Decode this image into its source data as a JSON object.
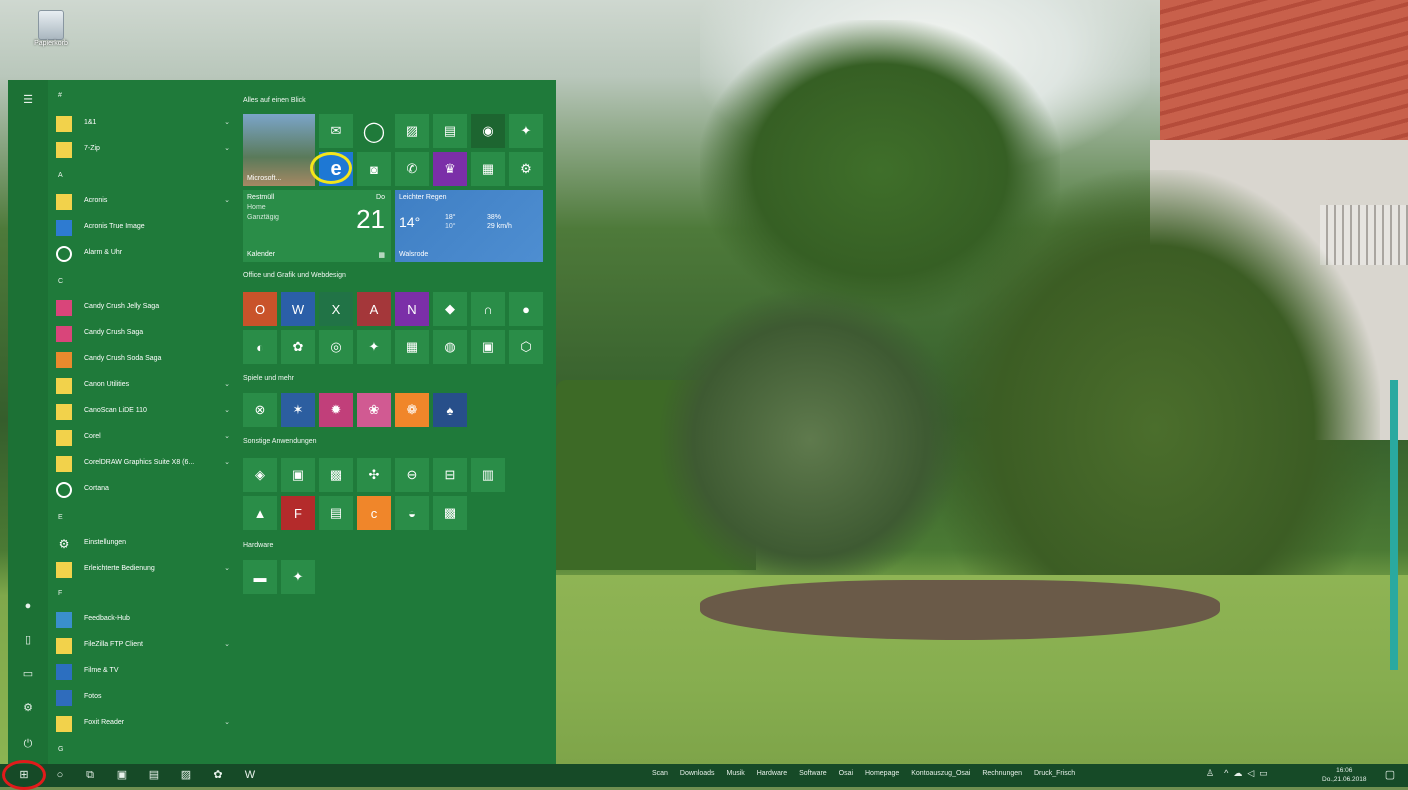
{
  "desktop": {
    "recycle_bin_label": "Papierkorb"
  },
  "start_menu": {
    "groups": {
      "hash": "#",
      "a": "A",
      "c": "C",
      "e": "E",
      "f": "F",
      "g": "G"
    },
    "apps": [
      {
        "label": "1&1",
        "chevron": "⌄"
      },
      {
        "label": "7-Zip",
        "chevron": "⌄"
      },
      {
        "label": "Acronis",
        "chevron": "⌄"
      },
      {
        "label": "Acronis True Image"
      },
      {
        "label": "Alarm & Uhr"
      },
      {
        "label": "Candy Crush Jelly Saga"
      },
      {
        "label": "Candy Crush Saga"
      },
      {
        "label": "Candy Crush Soda Saga"
      },
      {
        "label": "Canon Utilities",
        "chevron": "⌄"
      },
      {
        "label": "CanoScan LiDE 110",
        "chevron": "⌄"
      },
      {
        "label": "Corel",
        "chevron": "⌄"
      },
      {
        "label": "CorelDRAW Graphics Suite X8 (6...",
        "chevron": "⌄"
      },
      {
        "label": "Cortana"
      },
      {
        "label": "Einstellungen"
      },
      {
        "label": "Erleichterte Bedienung",
        "chevron": "⌄"
      },
      {
        "label": "Feedback-Hub"
      },
      {
        "label": "FileZilla FTP Client",
        "chevron": "⌄"
      },
      {
        "label": "Filme & TV"
      },
      {
        "label": "Fotos"
      },
      {
        "label": "Foxit Reader",
        "chevron": "⌄"
      }
    ],
    "sections": {
      "s1": "Alles auf einen Blick",
      "s2": "Office und Grafik und Webdesign",
      "s3": "Spiele und mehr",
      "s4": "Sonstige Anwendungen",
      "s5": "Hardware"
    },
    "calendar_tile": {
      "event": "Restmüll",
      "sub1": "Home",
      "sub2": "Ganztägig",
      "weekday": "Do",
      "day": "21",
      "label": "Kalender"
    },
    "weather_tile": {
      "condition": "Leichter Regen",
      "temp": "14°",
      "hi": "18°",
      "lo": "10°",
      "humidity": "38%",
      "wind": "29 km/h",
      "location": "Walsrode"
    },
    "roblox_tile_label": "Microsoft..."
  },
  "taskbar": {
    "links": [
      "Scan",
      "Downloads",
      "Musik",
      "Hardware",
      "Software",
      "Osai",
      "Homepage",
      "Kontoauszug_Osai",
      "Rechnungen",
      "Druck_Frisch"
    ],
    "clock_time": "16:06",
    "clock_date": "Do.,21.06.2018"
  },
  "colors": {
    "start_bg": "#1f7a3a",
    "tile": "#2a8d48",
    "taskbar": "#164a27",
    "highlight_red": "#e11b1b",
    "highlight_yellow": "#f3e61a"
  }
}
